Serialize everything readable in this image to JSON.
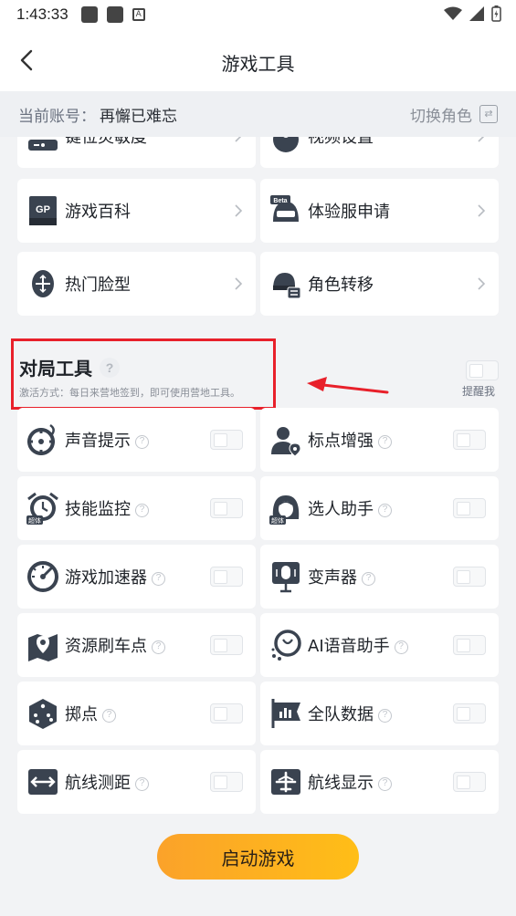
{
  "status_bar": {
    "time": "1:43:33",
    "notif_badge": "A"
  },
  "header": {
    "title": "游戏工具"
  },
  "account": {
    "label": "当前账号：",
    "name": "再懈已难忘",
    "switch_label": "切换角色",
    "switch_icon": "⇄"
  },
  "feature_tools": [
    {
      "label": "键位灵敏度",
      "icon": "keyboard-icon"
    },
    {
      "label": "视频设置",
      "icon": "video-settings-icon"
    },
    {
      "label": "游戏百科",
      "icon": "gp-book-icon"
    },
    {
      "label": "体验服申请",
      "icon": "beta-helmet-icon",
      "badge": "Beta"
    },
    {
      "label": "热门脸型",
      "icon": "face-icon"
    },
    {
      "label": "角色转移",
      "icon": "character-transfer-icon"
    }
  ],
  "match_tools_section": {
    "title": "对局工具",
    "help": "?",
    "description": "激活方式：每日来营地签到，即可使用营地工具。",
    "remind_label": "提醒我",
    "remind_enabled": false
  },
  "match_tools": [
    {
      "label": "声音提示",
      "help": "?",
      "enabled": false,
      "icon": "sound-crosshair-icon"
    },
    {
      "label": "标点增强",
      "help": "?",
      "enabled": false,
      "icon": "marker-person-icon"
    },
    {
      "label": "技能监控",
      "help": "?",
      "enabled": false,
      "icon": "skill-monitor-icon",
      "badge": "超体"
    },
    {
      "label": "选人助手",
      "help": "?",
      "enabled": false,
      "icon": "pick-assistant-icon",
      "badge": "超体"
    },
    {
      "label": "游戏加速器",
      "help": "?",
      "enabled": false,
      "icon": "speedometer-icon"
    },
    {
      "label": "变声器",
      "help": "?",
      "enabled": false,
      "icon": "microphone-icon"
    },
    {
      "label": "资源刷车点",
      "help": "?",
      "enabled": false,
      "icon": "map-pin-icon"
    },
    {
      "label": "AI语音助手",
      "help": "?",
      "enabled": false,
      "icon": "ai-voice-icon"
    },
    {
      "label": "掷点",
      "help": "?",
      "enabled": false,
      "icon": "dice-icon"
    },
    {
      "label": "全队数据",
      "help": "?",
      "enabled": false,
      "icon": "team-data-icon"
    },
    {
      "label": "航线测距",
      "help": "?",
      "enabled": false,
      "icon": "route-distance-icon"
    },
    {
      "label": "航线显示",
      "help": "?",
      "enabled": false,
      "icon": "airplane-icon"
    }
  ],
  "start_button": {
    "label": "启动游戏"
  },
  "colors": {
    "accent_start": "#fba22a",
    "accent_end": "#ffbe17",
    "highlight": "#e8202a",
    "background": "#f2f3f5"
  }
}
